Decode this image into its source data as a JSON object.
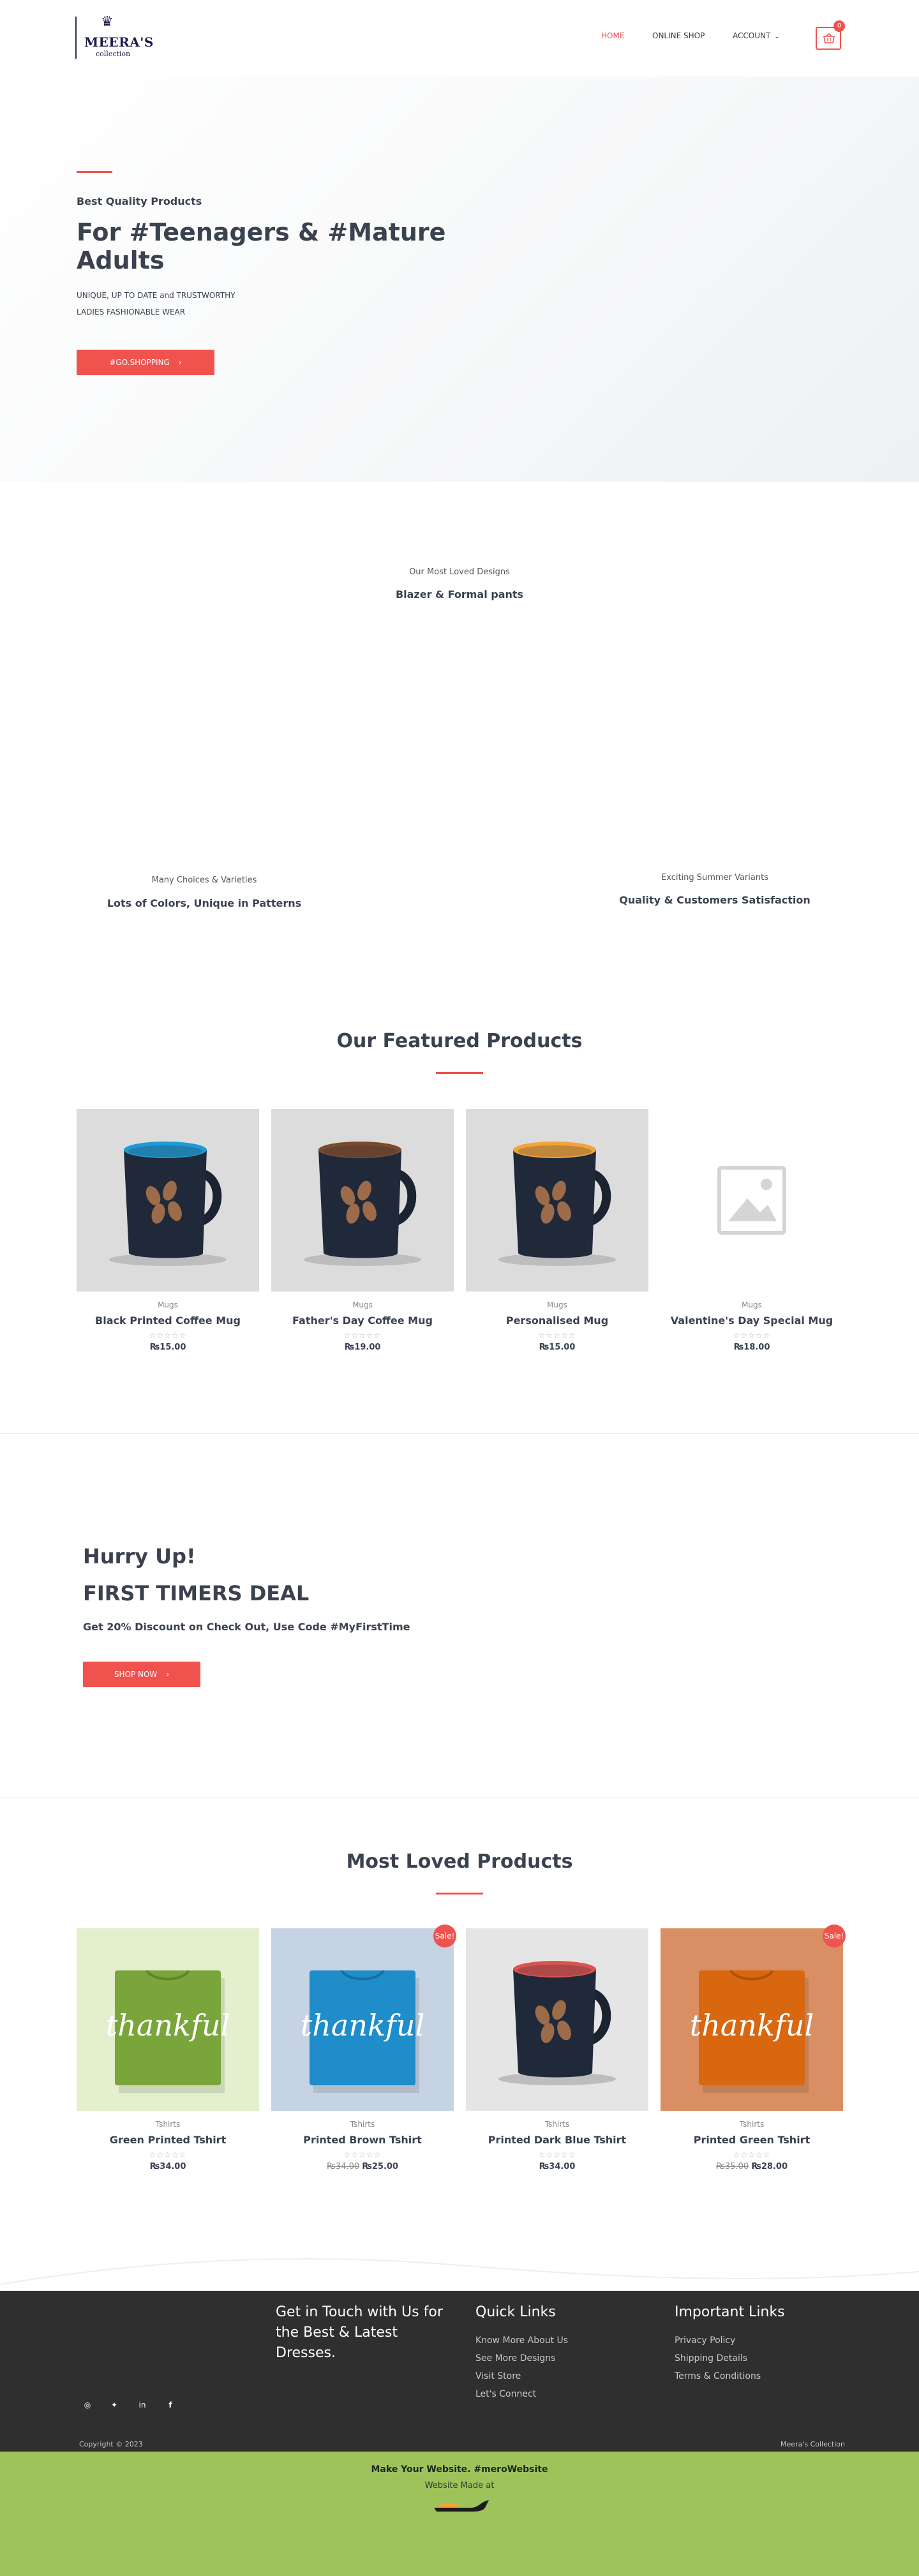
{
  "header": {
    "logo_name": "MEERA'S",
    "logo_sub": "collection",
    "nav": [
      {
        "label": "HOME"
      },
      {
        "label": "ONLINE SHOP"
      },
      {
        "label": "ACCOUNT"
      }
    ],
    "cart_count": "0",
    "accent_color": "#f0524e"
  },
  "hero": {
    "subtitle": "Best Quality Products",
    "title": "For #Teenagers & #Mature Adults",
    "desc_line1": "UNIQUE, UP TO DATE and TRUSTWORTHY",
    "desc_line2": "LADIES FASHIONABLE WEAR",
    "button": "#GO.SHOPPING"
  },
  "designs": {
    "top_small": "Our Most Loved Designs",
    "top_title": "Blazer & Formal pants",
    "left_small": "Many Choices & Varieties",
    "left_title": "Lots of Colors, Unique in Patterns",
    "right_small": "Exciting Summer Variants",
    "right_title": "Quality & Customers Satisfaction"
  },
  "featured": {
    "title": "Our Featured Products",
    "products": [
      {
        "category": "Mugs",
        "name": "Black Printed Coffee Mug",
        "price": "₨15.00",
        "old_price": "",
        "rim": "#1e9ad6",
        "image": "mug"
      },
      {
        "category": "Mugs",
        "name": "Father's Day Coffee Mug",
        "price": "₨19.00",
        "old_price": "",
        "rim": "#7a4a2e",
        "image": "mug"
      },
      {
        "category": "Mugs",
        "name": "Personalised Mug",
        "price": "₨15.00",
        "old_price": "",
        "rim": "#f2a33a",
        "image": "mug"
      },
      {
        "category": "Mugs",
        "name": "Valentine's Day Special Mug",
        "price": "₨18.00",
        "old_price": "",
        "rim": "",
        "image": "placeholder"
      }
    ]
  },
  "deal": {
    "small": "Hurry Up!",
    "big": "FIRST TIMERS DEAL",
    "text": "Get 20% Discount on Check Out, Use Code #MyFirstTime",
    "button": "SHOP NOW"
  },
  "loved": {
    "title": "Most Loved Products",
    "sale_label": "Sale!",
    "products": [
      {
        "category": "Tshirts",
        "name": "Green Printed Tshirt",
        "price": "₨34.00",
        "old_price": "",
        "sale": false,
        "bg": "#e3efcd",
        "shirt": "#7aa53a",
        "image": "tshirt"
      },
      {
        "category": "Tshirts",
        "name": "Printed Brown Tshirt",
        "price": "₨25.00",
        "old_price": "₨34.00",
        "sale": true,
        "bg": "#c6d3e2",
        "shirt": "#1e8dc9",
        "image": "tshirt"
      },
      {
        "category": "Tshirts",
        "name": "Printed Dark Blue Tshirt",
        "price": "₨34.00",
        "old_price": "",
        "sale": false,
        "bg": "#e5e5e5",
        "shirt": "#d9534f",
        "image": "mug"
      },
      {
        "category": "Tshirts",
        "name": "Printed Green Tshirt",
        "price": "₨28.00",
        "old_price": "₨35.00",
        "sale": true,
        "bg": "#d98f63",
        "shirt": "#d8670f",
        "image": "tshirt"
      }
    ],
    "shirt_text": "thankful"
  },
  "footer": {
    "tagline": "Get in Touch with Us for the Best & Latest Dresses.",
    "quick_title": "Quick Links",
    "quick_links": [
      "Know More About Us",
      "See More Designs",
      "Visit Store",
      "Let's Connect"
    ],
    "important_title": "Important Links",
    "important_links": [
      "Privacy Policy",
      "Shipping Details",
      "Terms & Conditions"
    ],
    "copyright": "Copyright © 2023",
    "brand": "Meera's Collection"
  },
  "bottom": {
    "line1": "Make Your Website. #meroWebsite",
    "line2": "Website Made at",
    "color": "#9dc35a"
  }
}
